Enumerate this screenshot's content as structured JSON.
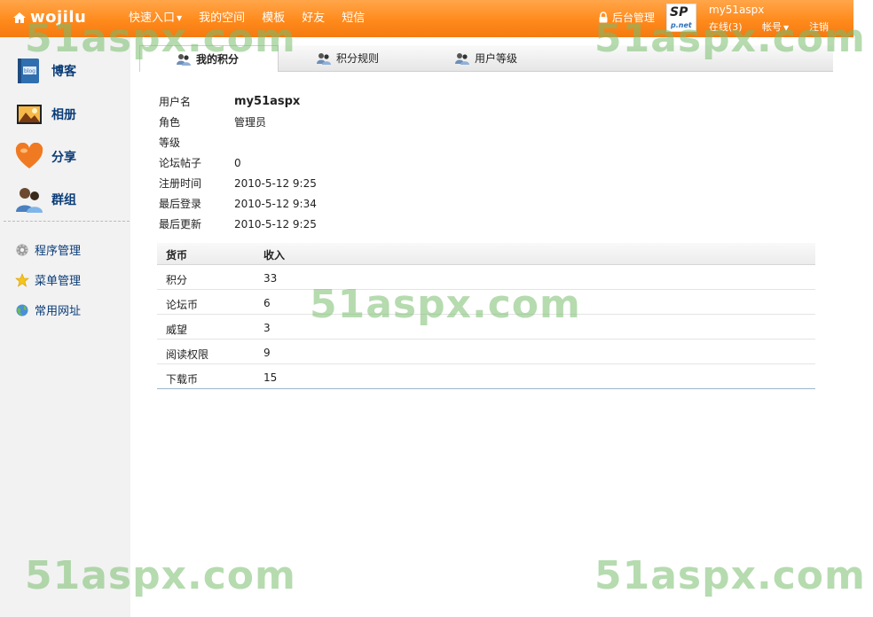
{
  "header": {
    "logo": "wojilu",
    "nav": [
      {
        "label": "快速入口",
        "dropdown": true
      },
      {
        "label": "我的空间",
        "dropdown": false
      },
      {
        "label": "模板",
        "dropdown": false
      },
      {
        "label": "好友",
        "dropdown": false
      },
      {
        "label": "短信",
        "dropdown": false
      }
    ],
    "admin_label": "后台管理",
    "avatar_text_top": "SP",
    "avatar_text_bottom": "p.net",
    "username": "my51aspx",
    "online": "在线(3)",
    "account": "帐号",
    "logout": "注销"
  },
  "sidebar": {
    "apps": [
      {
        "label": "博客",
        "icon": "blog-icon"
      },
      {
        "label": "相册",
        "icon": "photo-album-icon"
      },
      {
        "label": "分享",
        "icon": "heart-icon"
      },
      {
        "label": "群组",
        "icon": "group-icon"
      }
    ],
    "blog_icon_text": "blog",
    "manage": [
      {
        "label": "程序管理",
        "icon": "gear-icon"
      },
      {
        "label": "菜单管理",
        "icon": "star-icon"
      },
      {
        "label": "常用网址",
        "icon": "globe-icon"
      }
    ]
  },
  "tabs": [
    {
      "label": "我的积分",
      "active": true
    },
    {
      "label": "积分规则",
      "active": false
    },
    {
      "label": "用户等级",
      "active": false
    }
  ],
  "profile": {
    "rows": [
      {
        "label": "用户名",
        "value": "my51aspx"
      },
      {
        "label": "角色",
        "value": "管理员"
      },
      {
        "label": "等级",
        "value": ""
      },
      {
        "label": "论坛帖子",
        "value": "0"
      },
      {
        "label": "注册时间",
        "value": "2010-5-12 9:25"
      },
      {
        "label": "最后登录",
        "value": "2010-5-12 9:34"
      },
      {
        "label": "最后更新",
        "value": "2010-5-12 9:25"
      }
    ]
  },
  "currency_table": {
    "headers": [
      "货币",
      "收入"
    ],
    "rows": [
      [
        "积分",
        "33"
      ],
      [
        "论坛币",
        "6"
      ],
      [
        "威望",
        "3"
      ],
      [
        "阅读权限",
        "9"
      ],
      [
        "下载币",
        "15"
      ]
    ]
  },
  "watermark": "51aspx.com",
  "colors": {
    "topbar": "#ff8a1c",
    "link": "#0a3c78",
    "watermark": "#78be6e"
  }
}
